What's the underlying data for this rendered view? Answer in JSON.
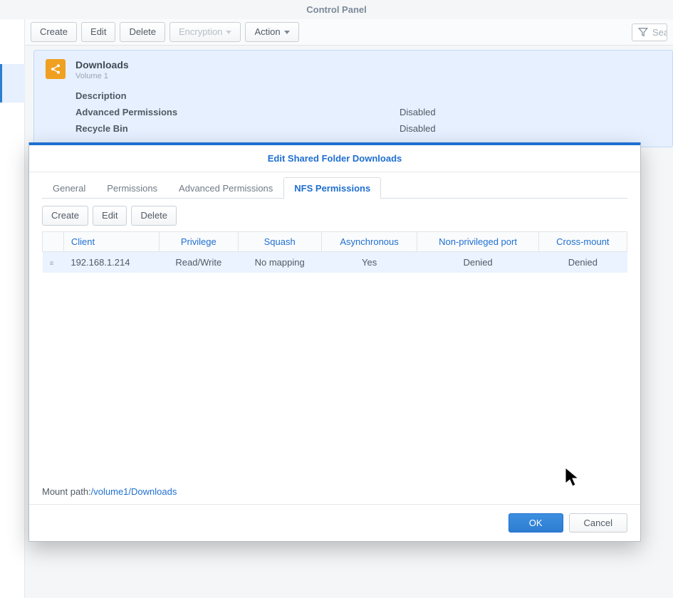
{
  "app_title": "Control Panel",
  "toolbar": {
    "create": "Create",
    "edit": "Edit",
    "delete": "Delete",
    "encryption": "Encryption",
    "action": "Action"
  },
  "search": {
    "placeholder": "Sea"
  },
  "folder": {
    "name": "Downloads",
    "volume": "Volume 1",
    "props": [
      {
        "label": "Description",
        "value": ""
      },
      {
        "label": "Advanced Permissions",
        "value": "Disabled"
      },
      {
        "label": "Recycle Bin",
        "value": "Disabled"
      }
    ]
  },
  "dialog": {
    "title": "Edit Shared Folder Downloads",
    "tabs": {
      "general": "General",
      "permissions": "Permissions",
      "advanced": "Advanced Permissions",
      "nfs": "NFS Permissions"
    },
    "toolbar": {
      "create": "Create",
      "edit": "Edit",
      "delete": "Delete"
    },
    "columns": {
      "client": "Client",
      "privilege": "Privilege",
      "squash": "Squash",
      "async": "Asynchronous",
      "nonpriv": "Non-privileged port",
      "cross": "Cross-mount"
    },
    "row": {
      "client": "192.168.1.214",
      "privilege": "Read/Write",
      "squash": "No mapping",
      "async": "Yes",
      "nonpriv": "Denied",
      "cross": "Denied"
    },
    "mount_label": "Mount path:",
    "mount_path": "/volume1/Downloads",
    "ok": "OK",
    "cancel": "Cancel"
  }
}
